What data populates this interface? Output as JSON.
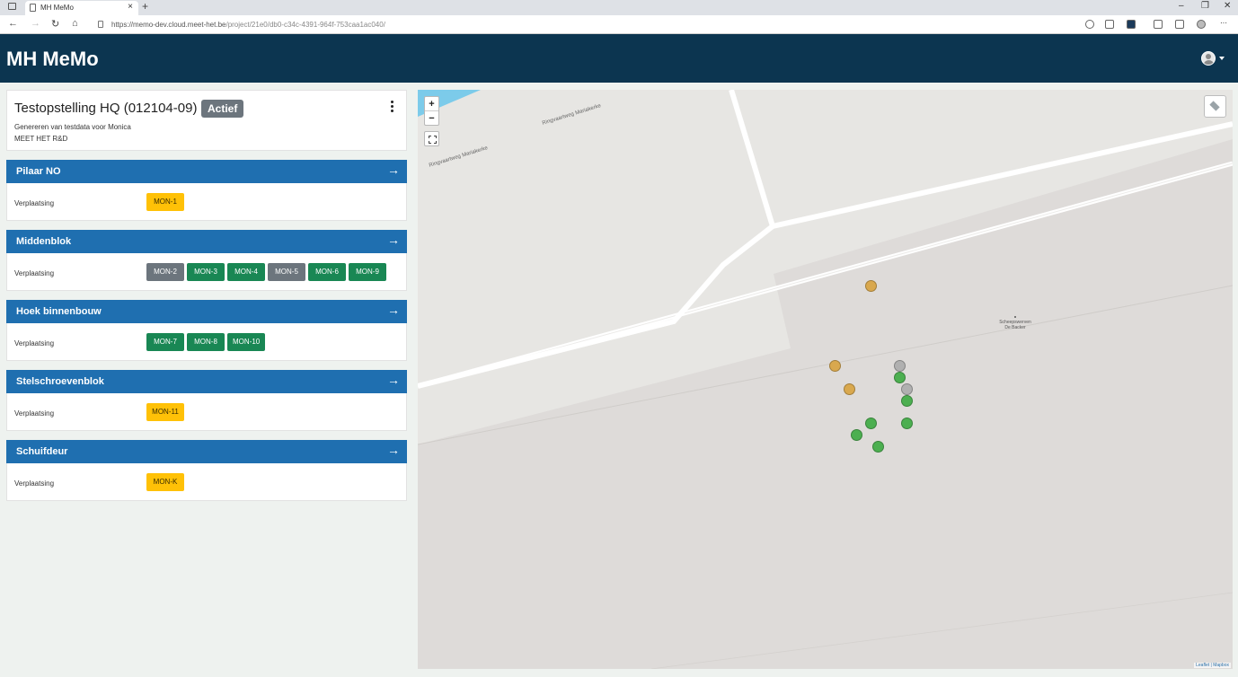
{
  "browser": {
    "tab_title": "MH MeMo",
    "url_host": "https://memo-dev.cloud.meet-het.be",
    "url_path": "/project/21e0/db0-c34c-4391-964f-753caa1ac040/"
  },
  "app": {
    "brand": "MH MeMo"
  },
  "project": {
    "title": "Testopstelling HQ (012104-09)",
    "status": "Actief",
    "description": "Genereren van testdata voor Monica",
    "organisation": "MEET HET R&D"
  },
  "groups": [
    {
      "name": "Pilaar NO",
      "row_label": "Verplaatsing",
      "monitors": [
        {
          "label": "MON-1",
          "state": "warning"
        }
      ]
    },
    {
      "name": "Middenblok",
      "row_label": "Verplaatsing",
      "monitors": [
        {
          "label": "MON-2",
          "state": "inactive"
        },
        {
          "label": "MON-3",
          "state": "ok"
        },
        {
          "label": "MON-4",
          "state": "ok"
        },
        {
          "label": "MON-5",
          "state": "inactive"
        },
        {
          "label": "MON-6",
          "state": "ok"
        },
        {
          "label": "MON-9",
          "state": "ok"
        }
      ]
    },
    {
      "name": "Hoek binnenbouw",
      "row_label": "Verplaatsing",
      "monitors": [
        {
          "label": "MON-7",
          "state": "ok"
        },
        {
          "label": "MON-8",
          "state": "ok"
        },
        {
          "label": "MON-10",
          "state": "ok"
        }
      ]
    },
    {
      "name": "Stelschroevenblok",
      "row_label": "Verplaatsing",
      "monitors": [
        {
          "label": "MON-11",
          "state": "warning"
        }
      ]
    },
    {
      "name": "Schuifdeur",
      "row_label": "Verplaatsing",
      "monitors": [
        {
          "label": "MON-K",
          "state": "warning"
        }
      ]
    }
  ],
  "state_colors": {
    "ok": {
      "bg": "#198754",
      "fg": "#ffffff"
    },
    "inactive": {
      "bg": "#6c757d",
      "fg": "#ffffff"
    },
    "warning": {
      "bg": "#ffc107",
      "fg": "#3a2c00"
    }
  },
  "map": {
    "zoom_in": "+",
    "zoom_out": "−",
    "road_label_1": "Ringvaartweg Mariakerke",
    "road_label_2": "Ringvaartweg Mariakerke",
    "poi_line1": "Scheepswerven",
    "poi_line2": "De Backer",
    "attribution": "Leaflet | Mapbox",
    "marker_colors": {
      "ok": "#4caf50",
      "inactive": "#b0b0b0",
      "warning": "#d9a84e"
    }
  }
}
